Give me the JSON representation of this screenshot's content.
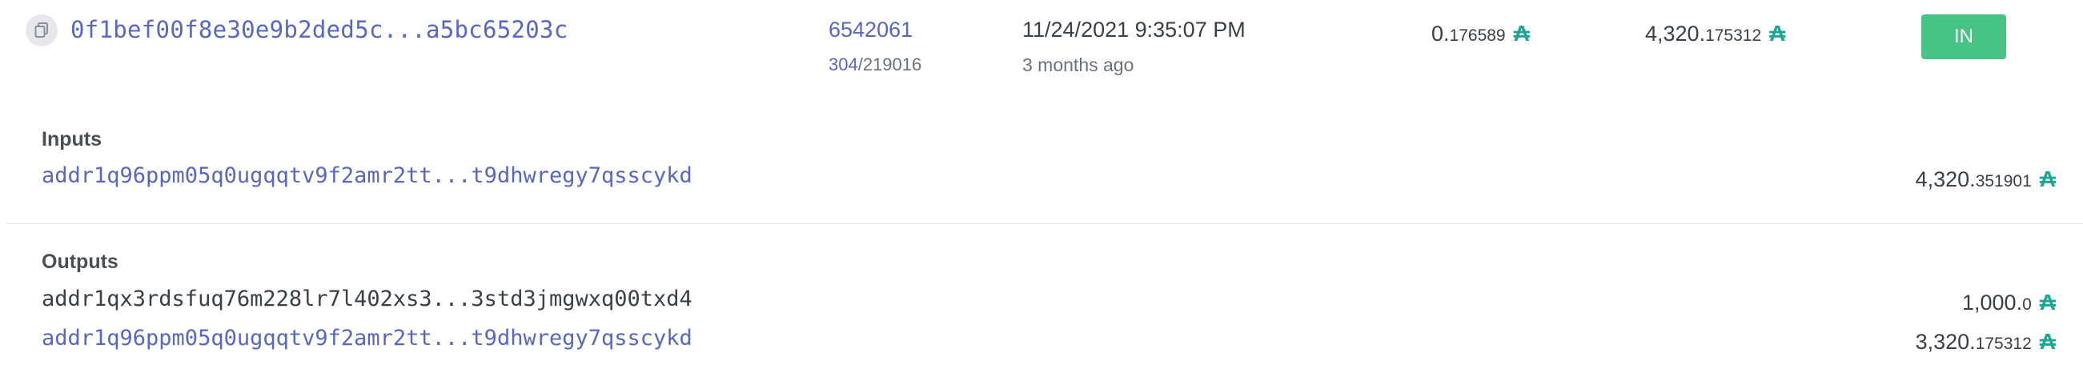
{
  "transaction": {
    "hash": "0f1bef00f8e30e9b2ded5c...a5bc65203c",
    "block": "6542061",
    "block_sub_link": "304",
    "block_sub_rest": "/219016",
    "date": "11/24/2021 9:35:07 PM",
    "relative_time": "3 months ago",
    "fee": {
      "int": "0.",
      "dec": "176589"
    },
    "total": {
      "int": "4,320.",
      "dec": "175312"
    },
    "direction": "IN"
  },
  "inputs": {
    "title": "Inputs",
    "items": [
      {
        "address": "addr1q96ppm05q0ugqqtv9f2amr2tt...t9dhwregy7qsscykd",
        "amount_int": "4,320.",
        "amount_dec": "351901"
      }
    ]
  },
  "outputs": {
    "title": "Outputs",
    "items": [
      {
        "address": "addr1qx3rdsfuq76m228lr7l402xs3...3std3jmgwxq00txd4",
        "amount_int": "1,000.",
        "amount_dec": "0"
      },
      {
        "address": "addr1q96ppm05q0ugqqtv9f2amr2tt...t9dhwregy7qsscykd",
        "amount_int": "3,320.",
        "amount_dec": "175312"
      }
    ]
  },
  "icons": {
    "currency": "ada-icon",
    "copy": "copy-icon"
  },
  "colors": {
    "link": "#5867c6",
    "ada": "#1aa892",
    "badge": "#47c485"
  }
}
